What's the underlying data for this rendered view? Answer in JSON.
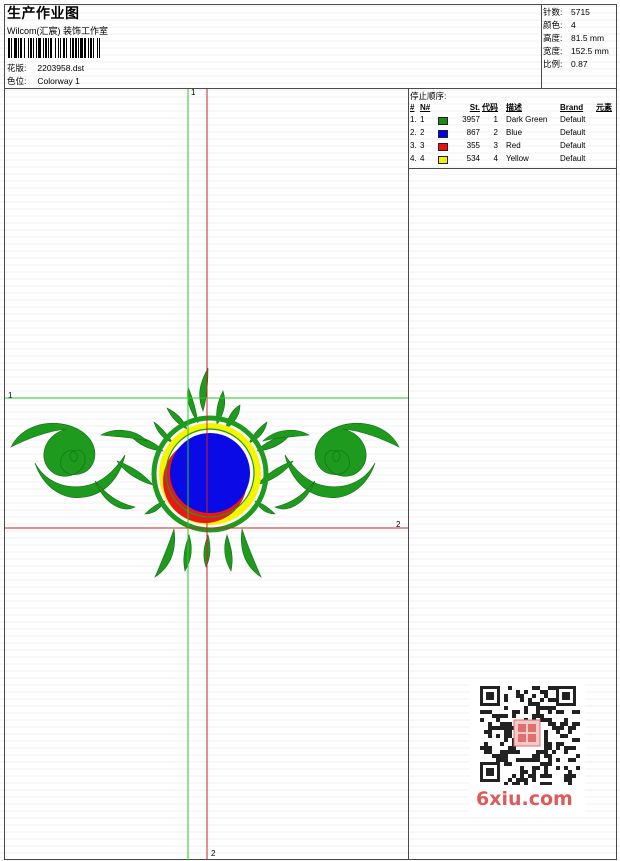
{
  "header": {
    "title": "生产作业图",
    "company": "Wilcom(汇宸) 装饰工作室",
    "design_label": "花版:",
    "design_value": "2203958.dst",
    "color_label": "色位:",
    "color_value": "Colorway 1"
  },
  "specs": [
    {
      "label": "针数:",
      "value": "5715"
    },
    {
      "label": "颜色:",
      "value": "4"
    },
    {
      "label": "高度:",
      "value": "81.5 mm"
    },
    {
      "label": "宽度:",
      "value": "152.5 mm"
    },
    {
      "label": "比例:",
      "value": "0.87"
    }
  ],
  "stop_sequence": {
    "title": "停止顺序:",
    "columns": [
      "#",
      "N#",
      "St.",
      "代码",
      "描述",
      "Brand",
      "元素"
    ],
    "rows": [
      {
        "num": "1.",
        "n": "1",
        "color": "#1a8a1a",
        "st": "3957",
        "code": "1",
        "desc": "Dark Green",
        "brand": "Default"
      },
      {
        "num": "2.",
        "n": "2",
        "color": "#0000ee",
        "st": "867",
        "code": "2",
        "desc": "Blue",
        "brand": "Default"
      },
      {
        "num": "3.",
        "n": "3",
        "color": "#ee1111",
        "st": "355",
        "code": "3",
        "desc": "Red",
        "brand": "Default"
      },
      {
        "num": "4.",
        "n": "4",
        "color": "#f2f200",
        "st": "534",
        "code": "4",
        "desc": "Yellow",
        "brand": "Default"
      }
    ]
  },
  "guides": {
    "green_label": "1",
    "red_label": "2"
  },
  "watermark": {
    "text": "6xiu.com"
  },
  "colors": {
    "green": "#1e9a1e",
    "blue": "#0a0ae6",
    "red": "#e81818",
    "yellow": "#f5f500",
    "guide_green": "#22cc22",
    "guide_red": "#cc2222"
  }
}
